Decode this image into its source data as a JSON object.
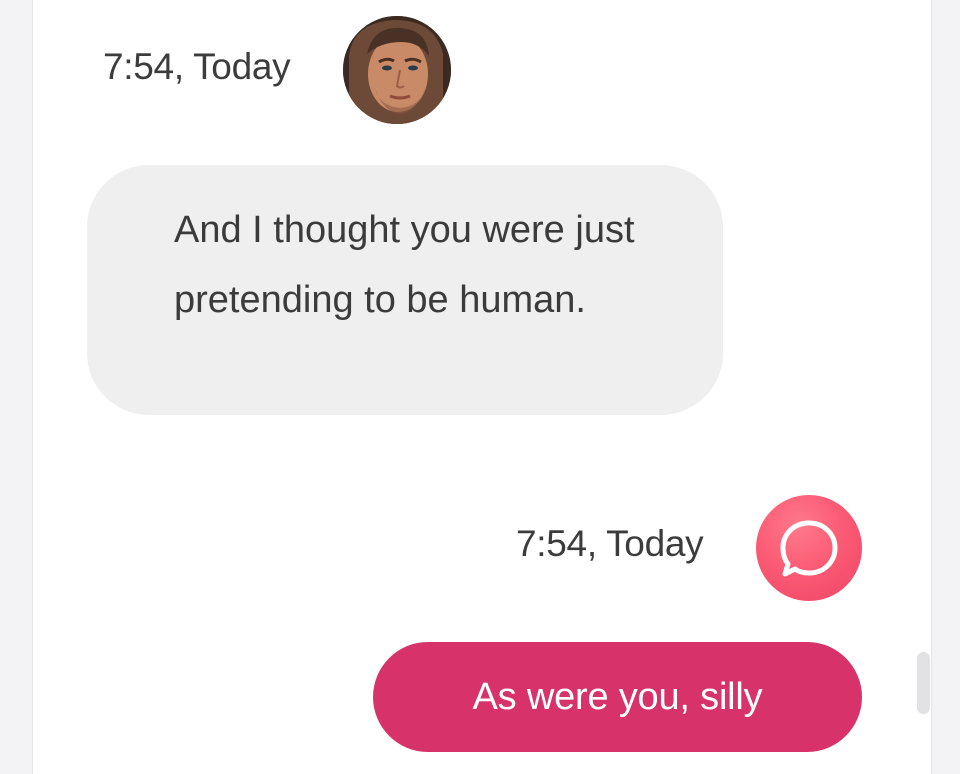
{
  "colors": {
    "incoming_bubble": "#efeff0",
    "outgoing_bubble": "#d7336a",
    "brand_icon": "#f54f6e",
    "text_dark": "#3b3b3b"
  },
  "messages": [
    {
      "direction": "incoming",
      "timestamp": "7:54, Today",
      "avatar": "user-photo-avatar",
      "text": "And I thought you were just pretending to be human."
    },
    {
      "direction": "outgoing",
      "timestamp": "7:54, Today",
      "avatar": "chat-bubble-icon",
      "text": "As were you, silly"
    }
  ]
}
